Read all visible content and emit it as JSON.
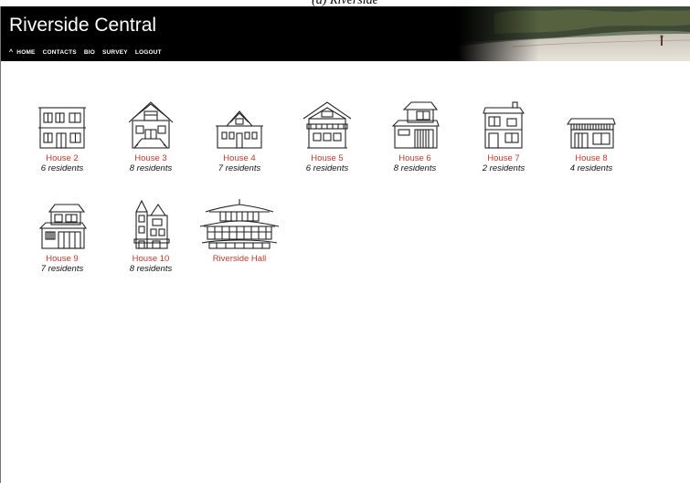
{
  "site": {
    "title": "Riverside Central"
  },
  "nav": {
    "home_icon": "chevron-up-icon",
    "items": [
      {
        "label": "HOME"
      },
      {
        "label": "CONTACTS"
      },
      {
        "label": "BIO"
      },
      {
        "label": "SURVEY"
      },
      {
        "label": "LOGOUT"
      }
    ]
  },
  "houses": [
    {
      "name": "House 2",
      "residents": "6 residents",
      "icon": "apartment-house-icon"
    },
    {
      "name": "House 3",
      "residents": "8 residents",
      "icon": "gabled-house-icon"
    },
    {
      "name": "House 4",
      "residents": "7 residents",
      "icon": "cottage-house-icon"
    },
    {
      "name": "House 5",
      "residents": "6 residents",
      "icon": "chalet-house-icon"
    },
    {
      "name": "House 6",
      "residents": "8 residents",
      "icon": "japanese-house-icon"
    },
    {
      "name": "House 7",
      "residents": "2 residents",
      "icon": "box-house-icon"
    },
    {
      "name": "House 8",
      "residents": "4 residents",
      "icon": "long-house-icon"
    },
    {
      "name": "House 9",
      "residents": "7 residents",
      "icon": "two-story-house-icon"
    },
    {
      "name": "House 10",
      "residents": "8 residents",
      "icon": "victorian-house-icon"
    },
    {
      "name": "Riverside Hall",
      "residents": "",
      "icon": "pagoda-hall-icon"
    }
  ],
  "colors": {
    "link": "#c0392b",
    "header_bg": "#000000"
  }
}
